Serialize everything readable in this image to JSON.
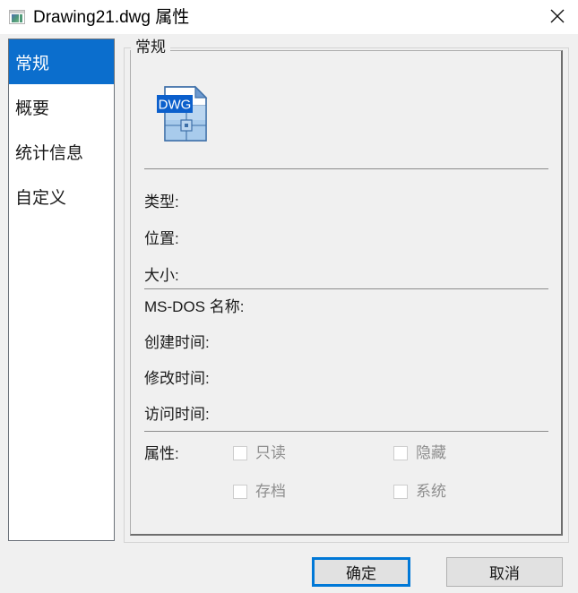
{
  "window": {
    "title": "Drawing21.dwg 属性",
    "icon": "app-window-icon",
    "close_label": "×",
    "accent_color": "#0078D7",
    "background_color": "#F0F0F0"
  },
  "sidebar": {
    "items": [
      {
        "label": "常规",
        "selected": true
      },
      {
        "label": "概要",
        "selected": false
      },
      {
        "label": "统计信息",
        "selected": false
      },
      {
        "label": "自定义",
        "selected": false
      }
    ]
  },
  "groupbox": {
    "title": "常规"
  },
  "file_icon": {
    "name": "dwg-file-icon",
    "badge_text": "DWG",
    "badge_color": "#0B5FCC",
    "body_color": "#A8CBEC",
    "outline_color": "#3D6FA8"
  },
  "fields": {
    "group1": [
      {
        "label": "类型:",
        "value": ""
      },
      {
        "label": "位置:",
        "value": ""
      },
      {
        "label": "大小:",
        "value": ""
      }
    ],
    "group2": [
      {
        "label": "MS-DOS  名称:",
        "value": ""
      },
      {
        "label": "创建时间:",
        "value": ""
      },
      {
        "label": "修改时间:",
        "value": ""
      },
      {
        "label": "访问时间:",
        "value": ""
      }
    ]
  },
  "attributes": {
    "label": "属性:",
    "checkboxes": [
      {
        "label": "只读",
        "checked": false,
        "disabled": true
      },
      {
        "label": "隐藏",
        "checked": false,
        "disabled": true
      },
      {
        "label": "存档",
        "checked": false,
        "disabled": true
      },
      {
        "label": "系统",
        "checked": false,
        "disabled": true
      }
    ]
  },
  "footer": {
    "ok_label": "确定",
    "cancel_label": "取消"
  }
}
